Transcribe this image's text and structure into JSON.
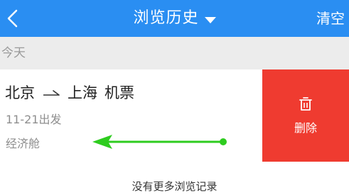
{
  "header": {
    "title": "浏览历史",
    "clear_label": "清空",
    "back_icon": "chevron-left-icon",
    "dropdown_icon": "caret-down-icon",
    "background_color": "#2a8ef2"
  },
  "section": {
    "label": "今天"
  },
  "items": [
    {
      "from": "北京",
      "to": "上海",
      "type": "机票",
      "date": "11-21出发",
      "cabin": "经济舱",
      "route_icon": "one-way-arrow-icon",
      "delete_label": "删除",
      "delete_icon": "trash-icon",
      "delete_color": "#ef3b30"
    }
  ],
  "overlay": {
    "swipe_indicator": "swipe-left-arrow",
    "color": "#2ecc1f"
  },
  "footer": {
    "no_more_text": "没有更多浏览记录"
  }
}
